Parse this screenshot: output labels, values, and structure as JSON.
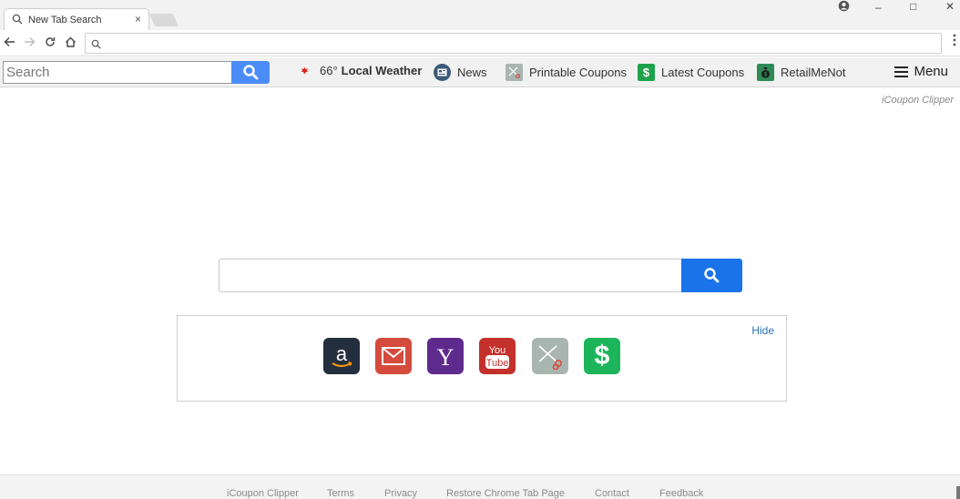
{
  "browser": {
    "tab_title": "New Tab Search",
    "tab_close": "×",
    "window_controls": {
      "minimize": "–",
      "maximize": "□",
      "close": "✕"
    },
    "omnibox_value": ""
  },
  "toolbar": {
    "search_placeholder": "Search",
    "weather_temp": "66°",
    "weather_label": "Local Weather",
    "news_label": "News",
    "printable_label": "Printable Coupons",
    "latest_label": "Latest Coupons",
    "retailmenot_label": "RetailMeNot",
    "menu_label": "Menu",
    "colors": {
      "search_button": "#4b8df8",
      "latest_icon": "#1fa34a",
      "retailmenot_icon": "#2e8b57"
    }
  },
  "brand": "iCoupon Clipper",
  "main": {
    "search_value": "",
    "search_button_color": "#1a73e8"
  },
  "tiles": {
    "hide_label": "Hide",
    "items": [
      {
        "name": "amazon",
        "bg": "#232f3e"
      },
      {
        "name": "gmail",
        "bg": "#d54b3d"
      },
      {
        "name": "yahoo",
        "bg": "#5f2a8e"
      },
      {
        "name": "youtube",
        "bg": "#c4302b",
        "text": "You Tube"
      },
      {
        "name": "coupons",
        "bg": "#a9b5b1"
      },
      {
        "name": "cash",
        "bg": "#1db55b",
        "text": "$"
      }
    ]
  },
  "footer": {
    "links": [
      "iCoupon Clipper",
      "Terms",
      "Privacy",
      "Restore Chrome Tab Page",
      "Contact",
      "Feedback"
    ]
  }
}
